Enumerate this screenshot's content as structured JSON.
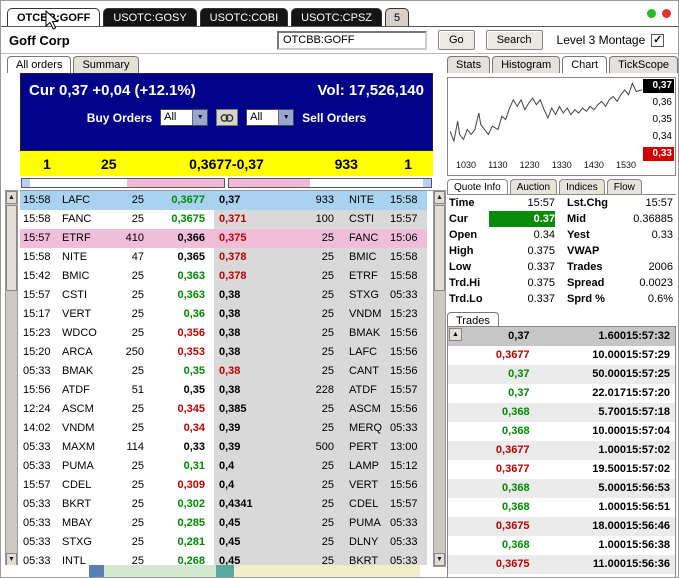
{
  "window": {
    "tabs": [
      {
        "label": "OTCBB:GOFF",
        "variant": "active"
      },
      {
        "label": "USOTC:GOSY",
        "variant": "dark"
      },
      {
        "label": "USOTC:COBI",
        "variant": "dark"
      },
      {
        "label": "USOTC:CPSZ",
        "variant": "dark"
      },
      {
        "label": "5",
        "variant": "plain"
      }
    ],
    "company": "Goff Corp",
    "symbol_input": "OTCBB:GOFF",
    "go_label": "Go",
    "search_label": "Search",
    "montage_label": "Level 3 Montage",
    "montage_checked": true
  },
  "left": {
    "tabs": [
      {
        "label": "All orders",
        "active": true
      },
      {
        "label": "Summary",
        "active": false
      }
    ],
    "summary_bar": {
      "cur": "Cur 0,37 +0,04 (+12.1%)",
      "vol": "Vol: 17,526,140"
    },
    "filters": {
      "buy_label": "Buy Orders",
      "buy_value": "All",
      "sell_value": "All",
      "sell_label": "Sell Orders"
    },
    "level1": {
      "bid_count": "1",
      "bid_size": "25",
      "range": "0,3677-0,37",
      "ask_size": "933",
      "ask_count": "1"
    },
    "orders": [
      {
        "bt": "15:58",
        "bm": "LAFC",
        "bs": "25",
        "bp": "0,3677",
        "bc": "g",
        "ap": "0,37",
        "ac": "k",
        "as": "933",
        "am": "NITE",
        "at": "15:58",
        "hl": "blue"
      },
      {
        "bt": "15:58",
        "bm": "FANC",
        "bs": "25",
        "bp": "0,3675",
        "bc": "g",
        "ap": "0,371",
        "ac": "r",
        "as": "100",
        "am": "CSTI",
        "at": "15:57"
      },
      {
        "bt": "15:57",
        "bm": "ETRF",
        "bs": "410",
        "bp": "0,366",
        "bc": "k",
        "ap": "0,375",
        "ac": "r",
        "as": "25",
        "am": "FANC",
        "at": "15:06",
        "hl": "pink"
      },
      {
        "bt": "15:58",
        "bm": "NITE",
        "bs": "47",
        "bp": "0,365",
        "bc": "k",
        "ap": "0,378",
        "ac": "r",
        "as": "25",
        "am": "BMIC",
        "at": "15:58"
      },
      {
        "bt": "15:42",
        "bm": "BMIC",
        "bs": "25",
        "bp": "0,363",
        "bc": "g",
        "ap": "0,378",
        "ac": "r",
        "as": "25",
        "am": "ETRF",
        "at": "15:58"
      },
      {
        "bt": "15:57",
        "bm": "CSTI",
        "bs": "25",
        "bp": "0,363",
        "bc": "g",
        "ap": "0,38",
        "ac": "k",
        "as": "25",
        "am": "STXG",
        "at": "05:33"
      },
      {
        "bt": "15:17",
        "bm": "VERT",
        "bs": "25",
        "bp": "0,36",
        "bc": "g",
        "ap": "0,38",
        "ac": "k",
        "as": "25",
        "am": "VNDM",
        "at": "15:23"
      },
      {
        "bt": "15:23",
        "bm": "WDCO",
        "bs": "25",
        "bp": "0,356",
        "bc": "r",
        "ap": "0,38",
        "ac": "k",
        "as": "25",
        "am": "BMAK",
        "at": "15:56"
      },
      {
        "bt": "15:20",
        "bm": "ARCA",
        "bs": "250",
        "bp": "0,353",
        "bc": "r",
        "ap": "0,38",
        "ac": "k",
        "as": "25",
        "am": "LAFC",
        "at": "15:56"
      },
      {
        "bt": "05:33",
        "bm": "BMAK",
        "bs": "25",
        "bp": "0,35",
        "bc": "g",
        "ap": "0,38",
        "ac": "r",
        "as": "25",
        "am": "CANT",
        "at": "15:56"
      },
      {
        "bt": "15:56",
        "bm": "ATDF",
        "bs": "51",
        "bp": "0,35",
        "bc": "k",
        "ap": "0,38",
        "ac": "k",
        "as": "228",
        "am": "ATDF",
        "at": "15:57"
      },
      {
        "bt": "12:24",
        "bm": "ASCM",
        "bs": "25",
        "bp": "0,345",
        "bc": "r",
        "ap": "0,385",
        "ac": "k",
        "as": "25",
        "am": "ASCM",
        "at": "15:56"
      },
      {
        "bt": "14:02",
        "bm": "VNDM",
        "bs": "25",
        "bp": "0,34",
        "bc": "r",
        "ap": "0,39",
        "ac": "k",
        "as": "25",
        "am": "MERQ",
        "at": "05:33"
      },
      {
        "bt": "05:33",
        "bm": "MAXM",
        "bs": "114",
        "bp": "0,33",
        "bc": "k",
        "ap": "0,39",
        "ac": "k",
        "as": "500",
        "am": "PERT",
        "at": "13:00"
      },
      {
        "bt": "05:33",
        "bm": "PUMA",
        "bs": "25",
        "bp": "0,31",
        "bc": "g",
        "ap": "0,4",
        "ac": "k",
        "as": "25",
        "am": "LAMP",
        "at": "15:12"
      },
      {
        "bt": "15:57",
        "bm": "CDEL",
        "bs": "25",
        "bp": "0,309",
        "bc": "r",
        "ap": "0,4",
        "ac": "k",
        "as": "25",
        "am": "VERT",
        "at": "15:56"
      },
      {
        "bt": "05:33",
        "bm": "BKRT",
        "bs": "25",
        "bp": "0,302",
        "bc": "g",
        "ap": "0,4341",
        "ac": "k",
        "as": "25",
        "am": "CDEL",
        "at": "15:57"
      },
      {
        "bt": "05:33",
        "bm": "MBAY",
        "bs": "25",
        "bp": "0,285",
        "bc": "g",
        "ap": "0,45",
        "ac": "k",
        "as": "25",
        "am": "PUMA",
        "at": "05:33"
      },
      {
        "bt": "05:33",
        "bm": "STXG",
        "bs": "25",
        "bp": "0,281",
        "bc": "g",
        "ap": "0,45",
        "ac": "k",
        "as": "25",
        "am": "DLNY",
        "at": "05:33"
      },
      {
        "bt": "05:33",
        "bm": "INTL",
        "bs": "25",
        "bp": "0,268",
        "bc": "g",
        "ap": "0,45",
        "ac": "k",
        "as": "25",
        "am": "BKRT",
        "at": "05:33"
      }
    ]
  },
  "right": {
    "tabs": [
      {
        "label": "Stats"
      },
      {
        "label": "Histogram"
      },
      {
        "label": "Chart",
        "active": true
      },
      {
        "label": "TickScope"
      }
    ],
    "chart": {
      "ylabels": [
        "0,37",
        "0,36",
        "0,35",
        "0,34",
        "0,33"
      ],
      "xlabels": [
        "1030",
        "1130",
        "1230",
        "1330",
        "1430",
        "1530"
      ],
      "points": [
        [
          0,
          0.346
        ],
        [
          0.02,
          0.34
        ],
        [
          0.04,
          0.352
        ],
        [
          0.05,
          0.344
        ],
        [
          0.07,
          0.341
        ],
        [
          0.09,
          0.347
        ],
        [
          0.11,
          0.344
        ],
        [
          0.13,
          0.347
        ],
        [
          0.15,
          0.357
        ],
        [
          0.16,
          0.35
        ],
        [
          0.18,
          0.347
        ],
        [
          0.2,
          0.344
        ],
        [
          0.22,
          0.349
        ],
        [
          0.25,
          0.347
        ],
        [
          0.27,
          0.355
        ],
        [
          0.29,
          0.353
        ],
        [
          0.31,
          0.36
        ],
        [
          0.33,
          0.365
        ],
        [
          0.35,
          0.361
        ],
        [
          0.37,
          0.365
        ],
        [
          0.39,
          0.359
        ],
        [
          0.41,
          0.363
        ],
        [
          0.43,
          0.366
        ],
        [
          0.45,
          0.362
        ],
        [
          0.47,
          0.365
        ],
        [
          0.49,
          0.359
        ],
        [
          0.51,
          0.354
        ],
        [
          0.53,
          0.36
        ],
        [
          0.55,
          0.356
        ],
        [
          0.57,
          0.361
        ],
        [
          0.59,
          0.357
        ],
        [
          0.61,
          0.36
        ],
        [
          0.63,
          0.356
        ],
        [
          0.65,
          0.359
        ],
        [
          0.67,
          0.357
        ],
        [
          0.69,
          0.36
        ],
        [
          0.71,
          0.358
        ],
        [
          0.73,
          0.361
        ],
        [
          0.75,
          0.359
        ],
        [
          0.77,
          0.362
        ],
        [
          0.79,
          0.364
        ],
        [
          0.81,
          0.361
        ],
        [
          0.83,
          0.365
        ],
        [
          0.85,
          0.367
        ],
        [
          0.87,
          0.364
        ],
        [
          0.89,
          0.368
        ],
        [
          0.91,
          0.371
        ],
        [
          0.93,
          0.368
        ],
        [
          0.95,
          0.375
        ],
        [
          0.97,
          0.37
        ],
        [
          1,
          0.371
        ]
      ]
    },
    "quote_tabs": [
      {
        "label": "Quote Info",
        "active": true
      },
      {
        "label": "Auction"
      },
      {
        "label": "Indices"
      },
      {
        "label": "Flow"
      }
    ],
    "quote_rows": [
      {
        "k1": "Time",
        "v1": "15:57",
        "k2": "Lst.Chg",
        "v2": "15:57"
      },
      {
        "k1": "Cur",
        "v1": "0.37",
        "v1_style": "cur",
        "k2": "Mid",
        "v2": "0.36885"
      },
      {
        "k1": "Open",
        "v1": "0.34",
        "k2": "Yest",
        "v2": "0.33"
      },
      {
        "k1": "High",
        "v1": "0.375",
        "k2": "VWAP",
        "v2": ""
      },
      {
        "k1": "Low",
        "v1": "0.337",
        "k2": "Trades",
        "v2": "2006"
      },
      {
        "k1": "Trd.Hi",
        "v1": "0.375",
        "k2": "Spread",
        "v2": "0.0023"
      },
      {
        "k1": "Trd.Lo",
        "v1": "0.337",
        "k2": "Sprd %",
        "v2": "0.6%"
      }
    ],
    "trades_label": "Trades",
    "trades": [
      {
        "price": "0,37",
        "size": "1.600",
        "time": "15:57:32",
        "color": "k",
        "selected": true
      },
      {
        "price": "0,3677",
        "size": "10.000",
        "time": "15:57:29",
        "color": "r"
      },
      {
        "price": "0,37",
        "size": "50.000",
        "time": "15:57:25",
        "color": "g"
      },
      {
        "price": "0,37",
        "size": "22.017",
        "time": "15:57:20",
        "color": "g"
      },
      {
        "price": "0,368",
        "size": "5.700",
        "time": "15:57:18",
        "color": "g"
      },
      {
        "price": "0,368",
        "size": "10.000",
        "time": "15:57:04",
        "color": "g"
      },
      {
        "price": "0,3677",
        "size": "1.000",
        "time": "15:57:02",
        "color": "r"
      },
      {
        "price": "0,3677",
        "size": "19.500",
        "time": "15:57:02",
        "color": "r"
      },
      {
        "price": "0,368",
        "size": "5.000",
        "time": "15:56:53",
        "color": "g"
      },
      {
        "price": "0,368",
        "size": "1.000",
        "time": "15:56:51",
        "color": "g"
      },
      {
        "price": "0,3675",
        "size": "18.000",
        "time": "15:56:46",
        "color": "r"
      },
      {
        "price": "0,368",
        "size": "1.000",
        "time": "15:56:38",
        "color": "g"
      },
      {
        "price": "0,3675",
        "size": "11.000",
        "time": "15:56:36",
        "color": "r"
      }
    ]
  },
  "colors": {
    "up": "#008a00",
    "down": "#c00000",
    "montage_blue": "#000289",
    "level1_yellow": "#ffff00",
    "highlight_blue": "#a9d2f0",
    "highlight_pink": "#f1bed9",
    "cur_green_bg": "#0a8a0a"
  }
}
